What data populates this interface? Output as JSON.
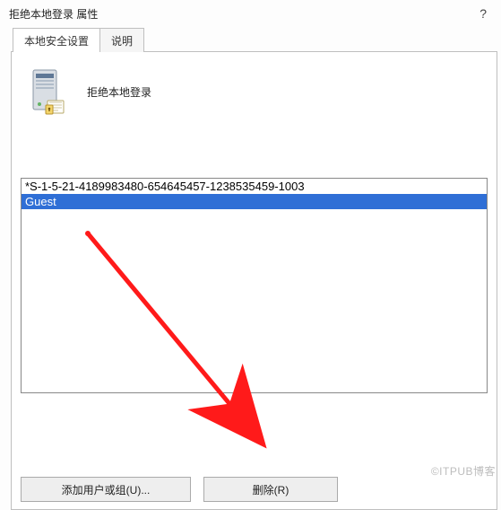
{
  "titlebar": {
    "title": "拒绝本地登录 属性",
    "help_symbol": "?"
  },
  "tabs": {
    "items": [
      {
        "label": "本地安全设置",
        "active": true
      },
      {
        "label": "说明",
        "active": false
      }
    ]
  },
  "policy": {
    "name": "拒绝本地登录"
  },
  "list": {
    "items": [
      {
        "text": "*S-1-5-21-4189983480-654645457-1238535459-1003",
        "selected": false
      },
      {
        "text": "Guest",
        "selected": true
      }
    ]
  },
  "buttons": {
    "add_label": "添加用户或组(U)...",
    "remove_label": "删除(R)"
  },
  "watermark": "©ITPUB博客",
  "annotations": {
    "arrow_color": "#ff1a1a"
  }
}
